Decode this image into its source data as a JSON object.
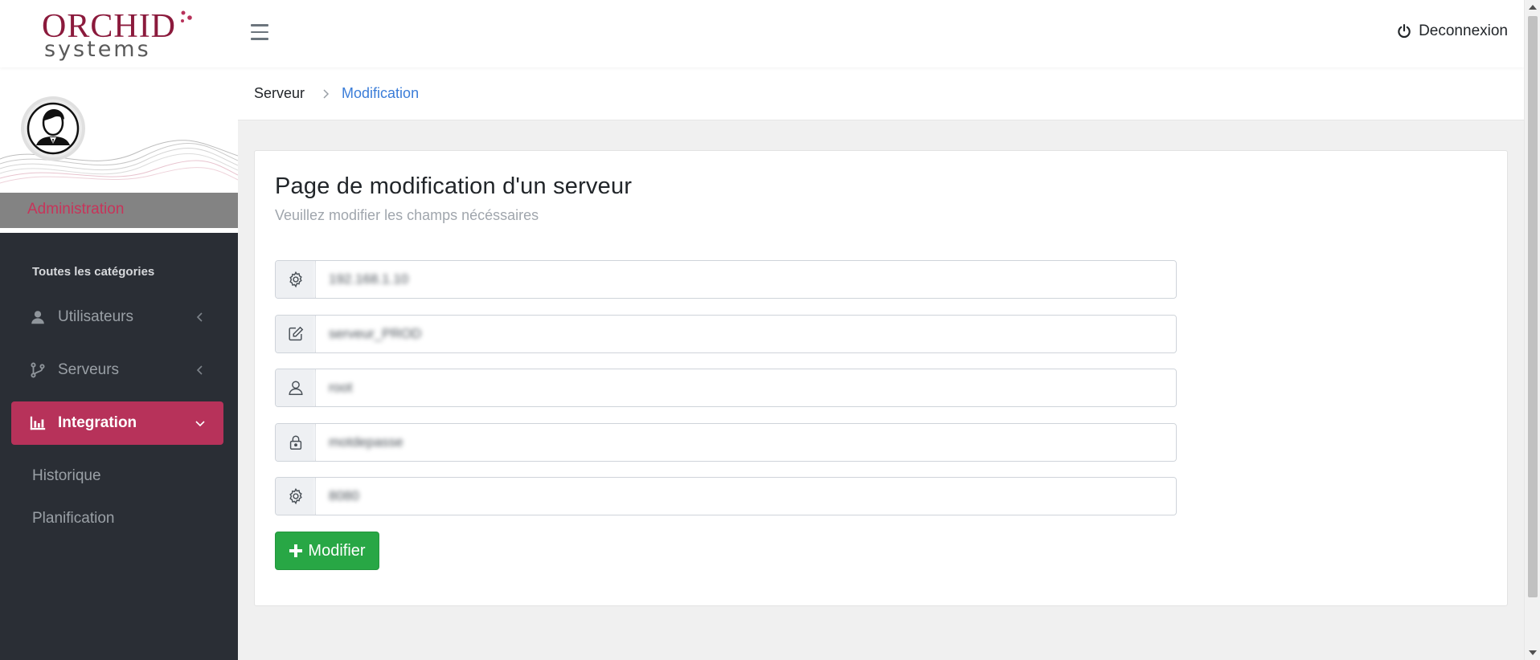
{
  "header": {
    "logo_top": "ORCHID",
    "logo_bottom": "systems",
    "logout_label": "Deconnexion"
  },
  "sidebar": {
    "role": "Administration",
    "category_label": "Toutes les catégories",
    "items": [
      {
        "label": "Utilisateurs",
        "icon": "user-icon"
      },
      {
        "label": "Serveurs",
        "icon": "git-branch-icon"
      },
      {
        "label": "Integration",
        "icon": "bar-chart-icon",
        "active": true
      }
    ],
    "sub_items": [
      "Historique",
      "Planification"
    ]
  },
  "breadcrumb": {
    "parent": "Serveur",
    "current": "Modification"
  },
  "form": {
    "title": "Page de modification d'un serveur",
    "subtitle": "Veuillez modifier les champs nécéssaires",
    "fields": [
      {
        "icon": "gear-icon",
        "value": "192.168.1.10"
      },
      {
        "icon": "edit-icon",
        "value": "serveur_PROD"
      },
      {
        "icon": "user-icon",
        "value": "root"
      },
      {
        "icon": "lock-icon",
        "value": "motdepasse"
      },
      {
        "icon": "gear-icon",
        "value": "8080"
      }
    ],
    "submit_label": "Modifier"
  },
  "colors": {
    "brand": "#8b1a3c",
    "accent": "#b7325a",
    "sidebar_bg": "#2a2e35",
    "success": "#28a745",
    "link": "#3b7dd8"
  }
}
